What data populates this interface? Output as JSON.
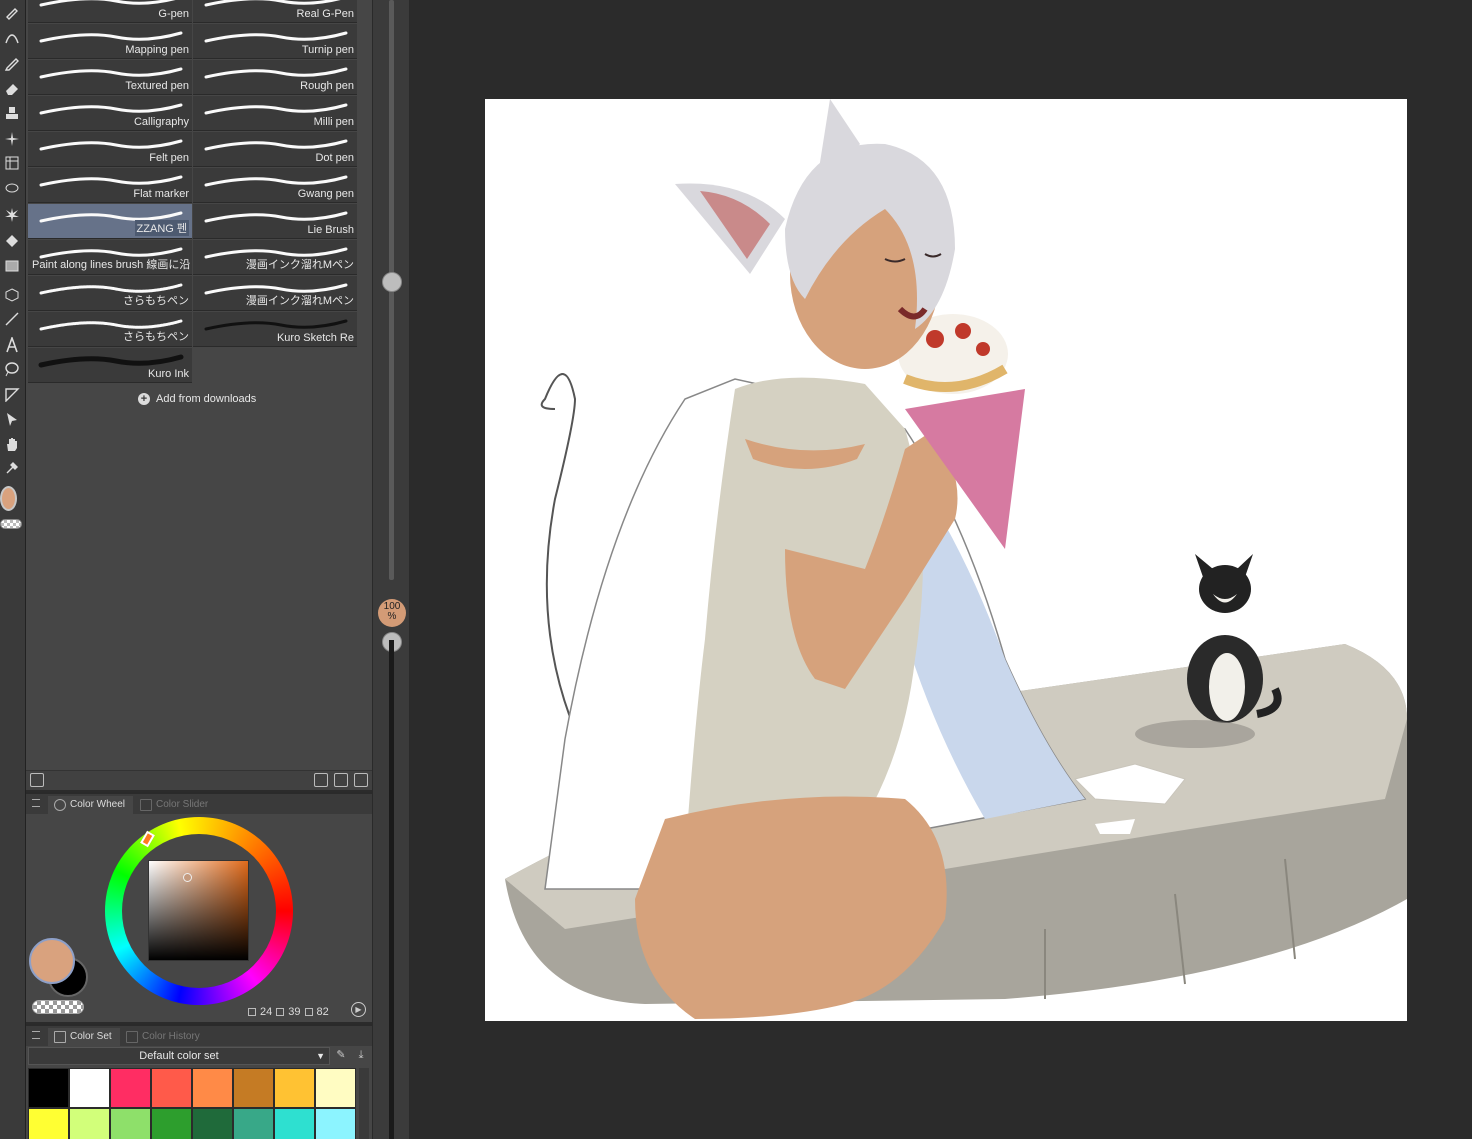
{
  "brushes": {
    "items": [
      {
        "label": "G-pen"
      },
      {
        "label": "Real G-Pen"
      },
      {
        "label": "Mapping pen"
      },
      {
        "label": "Turnip pen"
      },
      {
        "label": "Textured pen"
      },
      {
        "label": "Rough pen"
      },
      {
        "label": "Calligraphy"
      },
      {
        "label": "Milli pen"
      },
      {
        "label": "Felt pen"
      },
      {
        "label": "Dot pen"
      },
      {
        "label": "Flat marker"
      },
      {
        "label": "Gwang pen"
      },
      {
        "label": "ZZANG 펜"
      },
      {
        "label": "Lie Brush"
      },
      {
        "label": "Paint along lines brush 線画に沿"
      },
      {
        "label": "漫画インク溜れMペン"
      },
      {
        "label": "さらもちペン"
      },
      {
        "label": "漫画インク溜れMペン"
      },
      {
        "label": "さらもちペン"
      },
      {
        "label": "Kuro Sketch Re"
      },
      {
        "label": "Kuro Ink"
      }
    ],
    "selected": "ZZANG 펜",
    "add_label": "Add from downloads"
  },
  "color_wheel_panel": {
    "tabs": [
      "Color Wheel",
      "Color Slider"
    ],
    "active_tab": "Color Wheel",
    "hsv": {
      "h": "24",
      "s": "39",
      "v": "82"
    },
    "main_color": "#d9a27e",
    "sub_color": "#000000"
  },
  "color_set_panel": {
    "tabs": [
      "Color Set",
      "Color History"
    ],
    "active_tab": "Color Set",
    "selected_set": "Default color set",
    "swatches": [
      "#000000",
      "#ffffff",
      "#ff2d63",
      "#ff5a4a",
      "#ff8a47",
      "#c57b24",
      "#ffc233",
      "#fffcc2",
      "#ffff33",
      "#d2ff7a",
      "#8ee06a",
      "#2d9e2d",
      "#1f6a3a",
      "#38a888",
      "#2ee0d0",
      "#8cf4ff"
    ]
  },
  "zoom": {
    "value": "100",
    "unit": "%"
  },
  "colors": {
    "accent": "#667289",
    "panel": "#464646",
    "toolbar": "#3a3a3a"
  }
}
